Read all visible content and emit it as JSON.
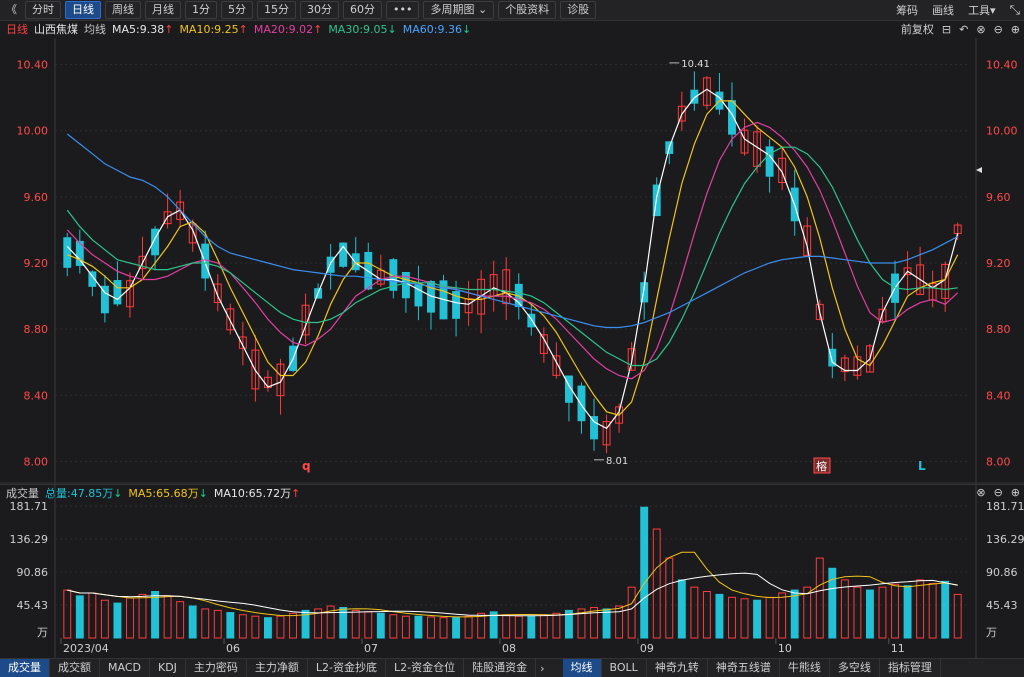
{
  "toolbar": {
    "back_label": "《",
    "tabs": [
      "分时",
      "日线",
      "周线",
      "月线",
      "1分",
      "5分",
      "15分",
      "30分",
      "60分",
      "•••",
      "多周期图 ⌄",
      "个股资料",
      "诊股"
    ],
    "active_tab": "日线",
    "right_links": [
      "筹码",
      "画线",
      "工具▾"
    ]
  },
  "ma_header": {
    "period": "日线",
    "stock": "山西焦煤",
    "avg_label": "均线",
    "ma5": "MA5:9.38",
    "ma10": "MA10:9.25",
    "ma20": "MA20:9.02",
    "ma30": "MA30:9.05",
    "ma60": "MA60:9.36",
    "restore_label": "前复权"
  },
  "volume_header": {
    "title": "成交量",
    "total": "总量:47.85万",
    "ma5": "MA5:65.68万",
    "ma10": "MA10:65.72万"
  },
  "markers": {
    "high_label": "10.41",
    "low_label": "8.01",
    "q_mark": "q",
    "rong_mark": "榕",
    "l_mark": "L"
  },
  "bottom_tabs_left": [
    "成交量",
    "成交额",
    "MACD",
    "KDJ",
    "主力密码",
    "主力净额",
    "L2-资金抄底",
    "L2-资金仓位",
    "陆股通资金"
  ],
  "bottom_tabs_right": [
    "均线",
    "BOLL",
    "神奇九转",
    "神奇五线谱",
    "牛熊线",
    "多空线",
    "指标管理"
  ],
  "colors": {
    "up": "#ff3b3b",
    "down": "#22c1d6",
    "ma5": "#ffffff",
    "ma10": "#f0c419",
    "ma20": "#e040a0",
    "ma30": "#2ec38a",
    "ma60": "#3a8ef0"
  },
  "chart_data": [
    {
      "type": "candlestick",
      "title": "山西焦煤 日线",
      "ylim": [
        7.9,
        10.5
      ],
      "yticks": [
        "10.40",
        "10.00",
        "9.60",
        "9.20",
        "8.80",
        "8.40",
        "8.00"
      ],
      "xticks": [
        "2023/04",
        "06",
        "07",
        "08",
        "09",
        "10",
        "11"
      ],
      "annotations": {
        "high": 10.41,
        "low": 8.01
      },
      "series": [
        {
          "name": "MA5",
          "values": [
            9.3,
            9.22,
            9.12,
            9.02,
            8.98,
            9.05,
            9.2,
            9.35,
            9.48,
            9.52,
            9.4,
            9.2,
            9.0,
            8.85,
            8.7,
            8.55,
            8.45,
            8.48,
            8.62,
            8.82,
            9.02,
            9.2,
            9.3,
            9.2,
            9.15,
            9.1,
            9.1,
            9.08,
            9.04,
            9.0,
            8.98,
            8.96,
            8.95,
            9.0,
            9.05,
            9.02,
            8.96,
            8.86,
            8.74,
            8.6,
            8.46,
            8.34,
            8.24,
            8.2,
            8.3,
            8.6,
            9.05,
            9.6,
            9.9,
            10.1,
            10.2,
            10.25,
            10.2,
            10.1,
            9.95,
            9.9,
            9.85,
            9.75,
            9.55,
            9.3,
            8.9,
            8.6,
            8.55,
            8.55,
            8.62,
            8.9,
            9.05,
            9.15,
            9.1,
            9.05,
            9.1,
            9.38
          ]
        },
        {
          "name": "MA10",
          "values": [
            9.25,
            9.22,
            9.18,
            9.12,
            9.05,
            9.05,
            9.1,
            9.2,
            9.3,
            9.42,
            9.45,
            9.38,
            9.22,
            9.05,
            8.9,
            8.75,
            8.6,
            8.52,
            8.52,
            8.6,
            8.76,
            8.95,
            9.1,
            9.2,
            9.2,
            9.16,
            9.12,
            9.1,
            9.08,
            9.05,
            9.03,
            9.0,
            8.98,
            8.98,
            9.0,
            9.02,
            9.0,
            8.95,
            8.88,
            8.78,
            8.65,
            8.52,
            8.4,
            8.3,
            8.28,
            8.36,
            8.6,
            8.98,
            9.35,
            9.68,
            9.92,
            10.1,
            10.18,
            10.18,
            10.1,
            10.02,
            9.96,
            9.9,
            9.78,
            9.6,
            9.35,
            9.05,
            8.8,
            8.62,
            8.58,
            8.7,
            8.85,
            9.0,
            9.05,
            9.08,
            9.1,
            9.25
          ]
        },
        {
          "name": "MA20",
          "values": [
            9.4,
            9.32,
            9.25,
            9.2,
            9.15,
            9.12,
            9.1,
            9.1,
            9.12,
            9.16,
            9.2,
            9.22,
            9.2,
            9.14,
            9.05,
            8.96,
            8.86,
            8.78,
            8.72,
            8.7,
            8.74,
            8.8,
            8.9,
            9.0,
            9.05,
            9.1,
            9.12,
            9.12,
            9.1,
            9.08,
            9.06,
            9.04,
            9.02,
            9.0,
            9.0,
            9.0,
            8.98,
            8.96,
            8.92,
            8.86,
            8.78,
            8.7,
            8.62,
            8.56,
            8.52,
            8.5,
            8.55,
            8.68,
            8.88,
            9.12,
            9.38,
            9.62,
            9.82,
            9.95,
            10.02,
            10.05,
            10.02,
            9.96,
            9.88,
            9.78,
            9.64,
            9.46,
            9.26,
            9.06,
            8.9,
            8.84,
            8.86,
            8.92,
            8.96,
            8.98,
            8.95,
            9.02
          ]
        },
        {
          "name": "MA30",
          "values": [
            9.52,
            9.42,
            9.34,
            9.28,
            9.22,
            9.2,
            9.18,
            9.16,
            9.16,
            9.18,
            9.2,
            9.2,
            9.18,
            9.14,
            9.08,
            9.02,
            8.96,
            8.9,
            8.86,
            8.84,
            8.84,
            8.86,
            8.9,
            8.96,
            9.0,
            9.04,
            9.06,
            9.08,
            9.08,
            9.08,
            9.06,
            9.05,
            9.04,
            9.04,
            9.04,
            9.03,
            9.02,
            9.0,
            8.96,
            8.9,
            8.84,
            8.78,
            8.72,
            8.66,
            8.62,
            8.58,
            8.58,
            8.62,
            8.72,
            8.86,
            9.02,
            9.2,
            9.38,
            9.54,
            9.68,
            9.78,
            9.86,
            9.9,
            9.9,
            9.86,
            9.78,
            9.66,
            9.5,
            9.34,
            9.2,
            9.1,
            9.05,
            9.04,
            9.05,
            9.05,
            9.04,
            9.05
          ]
        },
        {
          "name": "MA60",
          "values": [
            9.98,
            9.92,
            9.86,
            9.8,
            9.76,
            9.72,
            9.7,
            9.66,
            9.6,
            9.52,
            9.44,
            9.36,
            9.3,
            9.26,
            9.24,
            9.22,
            9.2,
            9.18,
            9.16,
            9.15,
            9.14,
            9.13,
            9.12,
            9.12,
            9.11,
            9.1,
            9.09,
            9.08,
            9.07,
            9.06,
            9.05,
            9.04,
            9.02,
            9.0,
            8.98,
            8.96,
            8.94,
            8.92,
            8.9,
            8.88,
            8.86,
            8.84,
            8.82,
            8.81,
            8.81,
            8.82,
            8.84,
            8.87,
            8.9,
            8.94,
            8.98,
            9.02,
            9.06,
            9.1,
            9.14,
            9.17,
            9.2,
            9.22,
            9.23,
            9.24,
            9.24,
            9.23,
            9.22,
            9.21,
            9.2,
            9.2,
            9.2,
            9.22,
            9.25,
            9.28,
            9.32,
            9.36
          ]
        }
      ]
    },
    {
      "type": "bar",
      "title": "成交量",
      "unit": "万",
      "ylim": [
        0,
        181.71
      ],
      "yticks": [
        "181.71",
        "136.29",
        "90.86",
        "45.43",
        "万"
      ],
      "values": [
        66,
        58,
        62,
        52,
        48,
        55,
        60,
        64,
        58,
        50,
        44,
        40,
        38,
        35,
        32,
        30,
        28,
        30,
        34,
        38,
        40,
        44,
        42,
        38,
        36,
        34,
        32,
        30,
        30,
        29,
        28,
        28,
        30,
        34,
        36,
        32,
        30,
        30,
        32,
        34,
        38,
        40,
        42,
        40,
        44,
        70,
        180,
        150,
        110,
        80,
        70,
        64,
        60,
        56,
        54,
        52,
        56,
        62,
        66,
        70,
        110,
        96,
        80,
        70,
        66,
        70,
        74,
        72,
        80,
        75,
        78,
        60
      ]
    }
  ]
}
